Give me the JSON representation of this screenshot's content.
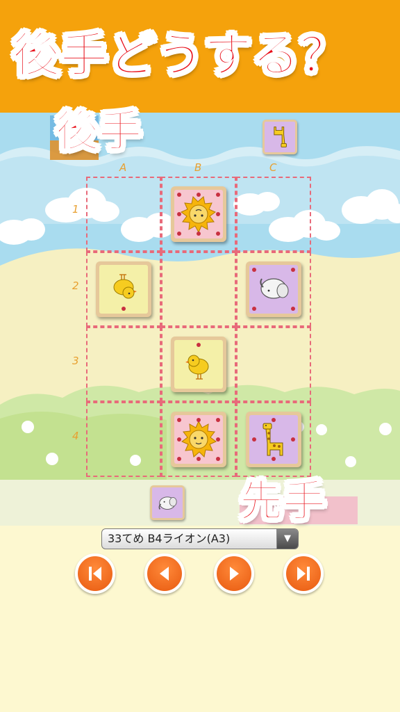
{
  "banner": {
    "title": "後手どうする？"
  },
  "labels": {
    "gote": "後手",
    "sente": "先手"
  },
  "board": {
    "columns": [
      "A",
      "B",
      "C"
    ],
    "rows": [
      "1",
      "2",
      "3",
      "4"
    ],
    "pieces": [
      {
        "cell": "B1",
        "type": "lion",
        "owner": "gote"
      },
      {
        "cell": "A2",
        "type": "chick",
        "owner": "gote"
      },
      {
        "cell": "C2",
        "type": "elephant",
        "owner": "gote"
      },
      {
        "cell": "B3",
        "type": "chick",
        "owner": "sente"
      },
      {
        "cell": "B4",
        "type": "lion",
        "owner": "sente"
      },
      {
        "cell": "C4",
        "type": "giraffe",
        "owner": "sente"
      }
    ]
  },
  "hands": {
    "gote": [
      {
        "type": "giraffe"
      }
    ],
    "sente": [
      {
        "type": "elephant"
      }
    ]
  },
  "move_select": {
    "value": "33てめ B4ライオン(A3)"
  },
  "nav": {
    "buttons": [
      {
        "name": "first-move-button",
        "icon": "skip-back-icon"
      },
      {
        "name": "prev-move-button",
        "icon": "play-back-icon"
      },
      {
        "name": "next-move-button",
        "icon": "play-icon"
      },
      {
        "name": "last-move-button",
        "icon": "skip-forward-icon"
      }
    ]
  },
  "colors": {
    "banner": "#f5a20c",
    "label_red": "#e8101a",
    "button_orange": "#e85a10",
    "grid_dash": "#e86a7a"
  }
}
